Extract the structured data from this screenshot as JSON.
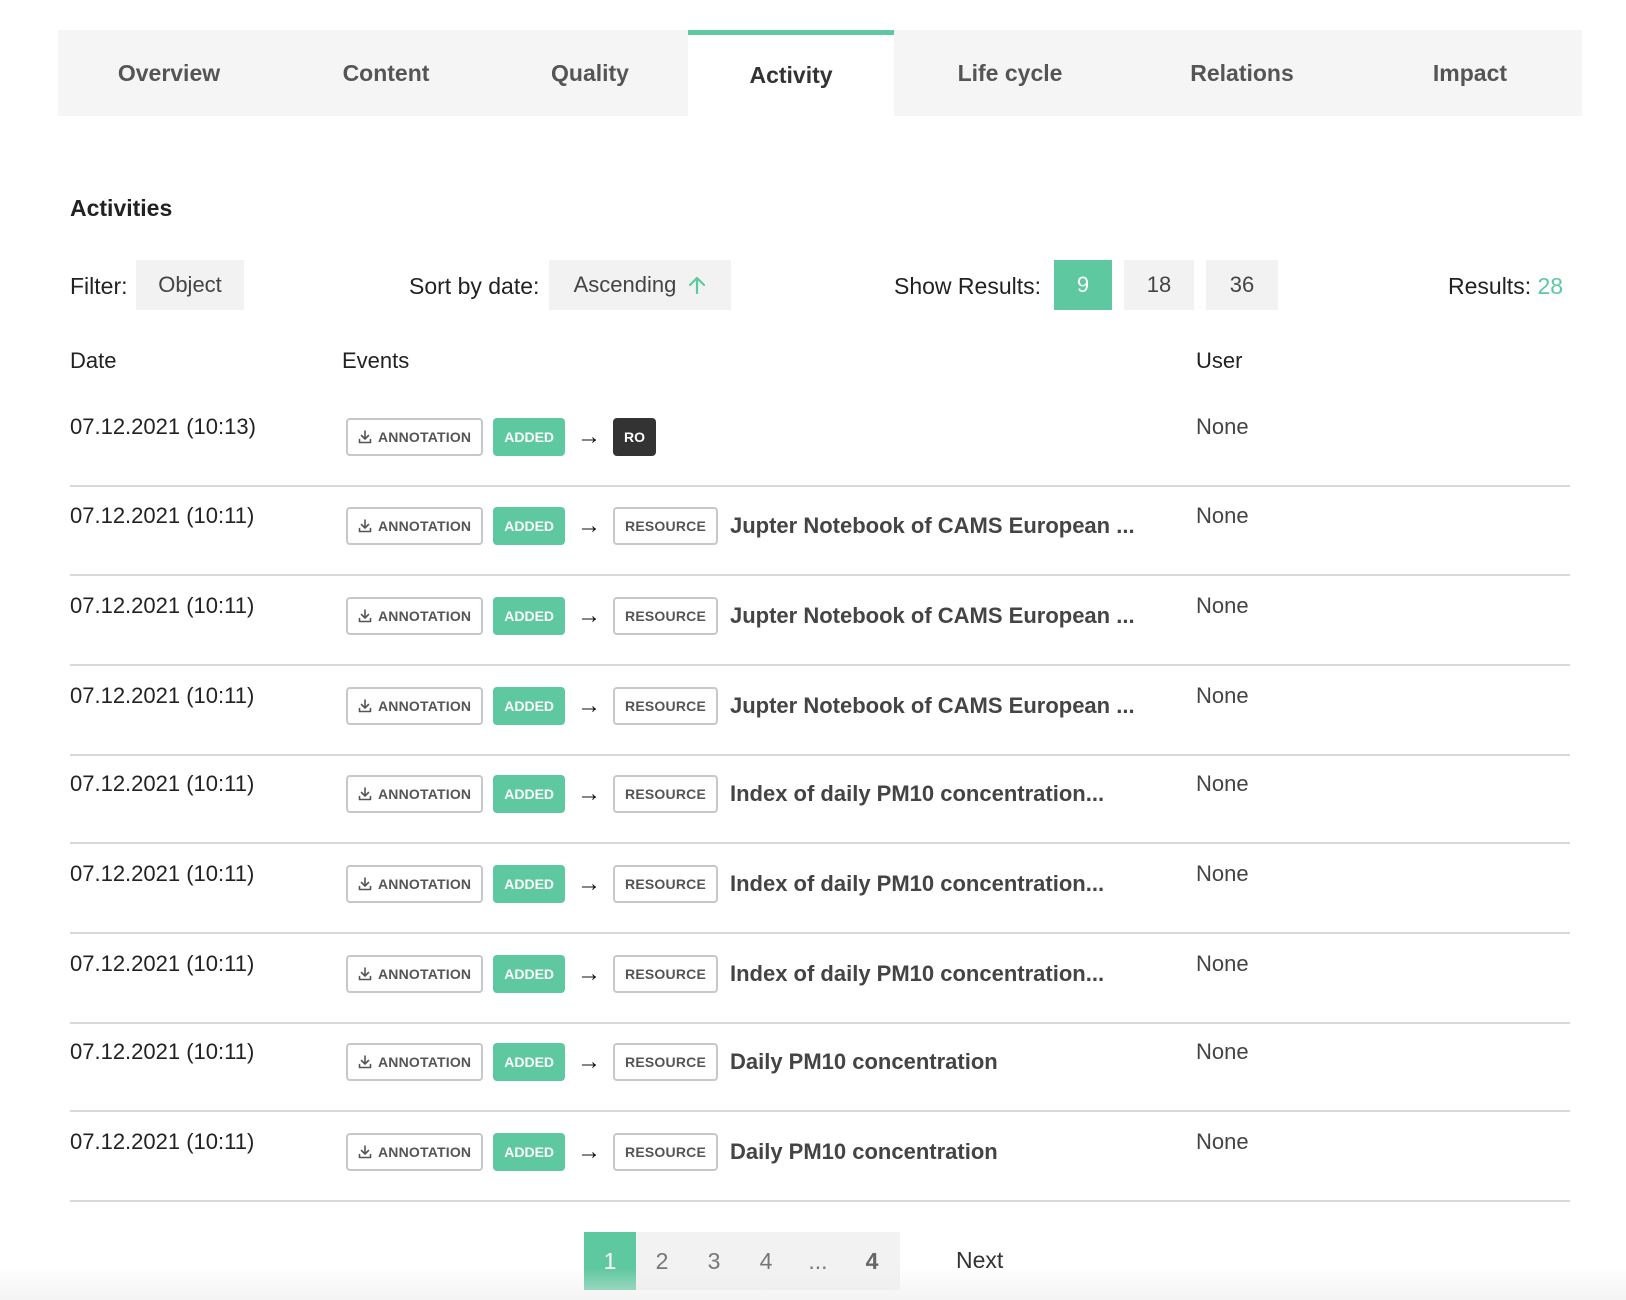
{
  "tabs": [
    {
      "label": "Overview",
      "active": false
    },
    {
      "label": "Content",
      "active": false
    },
    {
      "label": "Quality",
      "active": false
    },
    {
      "label": "Activity",
      "active": true
    },
    {
      "label": "Life cycle",
      "active": false
    },
    {
      "label": "Relations",
      "active": false
    },
    {
      "label": "Impact",
      "active": false
    }
  ],
  "section_title": "Activities",
  "filter": {
    "label": "Filter:",
    "value": "Object"
  },
  "sort": {
    "label": "Sort by date:",
    "value": "Ascending",
    "icon": "arrow-up-icon"
  },
  "show_results": {
    "label": "Show Results:",
    "options": [
      "9",
      "18",
      "36"
    ],
    "selected": "9"
  },
  "results": {
    "label": "Results:",
    "count": "28"
  },
  "table": {
    "headers": {
      "date": "Date",
      "events": "Events",
      "user": "User"
    },
    "rows": [
      {
        "date": "07.12.2021 (10:13)",
        "subject": "ANNOTATION",
        "action": "ADDED",
        "target_type": "RO",
        "target_name": "",
        "user": "None"
      },
      {
        "date": "07.12.2021 (10:11)",
        "subject": "ANNOTATION",
        "action": "ADDED",
        "target_type": "RESOURCE",
        "target_name": "Jupter Notebook of CAMS European ...",
        "user": "None"
      },
      {
        "date": "07.12.2021 (10:11)",
        "subject": "ANNOTATION",
        "action": "ADDED",
        "target_type": "RESOURCE",
        "target_name": "Jupter Notebook of CAMS European ...",
        "user": "None"
      },
      {
        "date": "07.12.2021 (10:11)",
        "subject": "ANNOTATION",
        "action": "ADDED",
        "target_type": "RESOURCE",
        "target_name": "Jupter Notebook of CAMS European ...",
        "user": "None"
      },
      {
        "date": "07.12.2021 (10:11)",
        "subject": "ANNOTATION",
        "action": "ADDED",
        "target_type": "RESOURCE",
        "target_name": "Index of daily PM10 concentration...",
        "user": "None"
      },
      {
        "date": "07.12.2021 (10:11)",
        "subject": "ANNOTATION",
        "action": "ADDED",
        "target_type": "RESOURCE",
        "target_name": "Index of daily PM10 concentration...",
        "user": "None"
      },
      {
        "date": "07.12.2021 (10:11)",
        "subject": "ANNOTATION",
        "action": "ADDED",
        "target_type": "RESOURCE",
        "target_name": "Index of daily PM10 concentration...",
        "user": "None"
      },
      {
        "date": "07.12.2021 (10:11)",
        "subject": "ANNOTATION",
        "action": "ADDED",
        "target_type": "RESOURCE",
        "target_name": "Daily PM10 concentration",
        "user": "None"
      },
      {
        "date": "07.12.2021 (10:11)",
        "subject": "ANNOTATION",
        "action": "ADDED",
        "target_type": "RESOURCE",
        "target_name": "Daily PM10 concentration",
        "user": "None"
      }
    ]
  },
  "pagination": {
    "pages": [
      "1",
      "2",
      "3",
      "4",
      "...",
      "4"
    ],
    "current": "1",
    "next_label": "Next"
  },
  "colors": {
    "accent": "#5ec8a0",
    "dark_tag": "#333333",
    "tab_bar": "#f5f5f5"
  }
}
